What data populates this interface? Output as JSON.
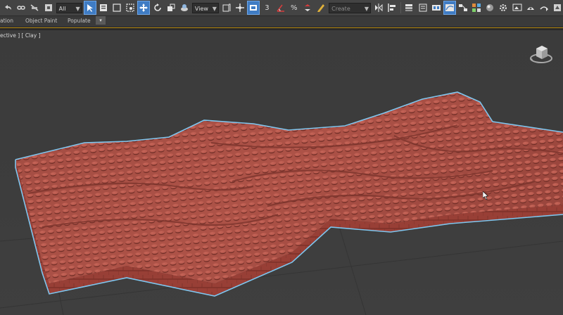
{
  "toolbar": {
    "selection_filter": "All",
    "view_dropdown": "View",
    "selection_set": "Create Selection Se",
    "percent_snap_label": "%",
    "snap_label": "3",
    "tools": [
      "undo-icon",
      "redo-icon",
      "link-icon",
      "unlink-icon",
      "bind-space-warp-icon",
      "select-object-icon",
      "select-by-name-icon",
      "rectangular-selection-region-icon",
      "window-crossing-icon",
      "select-and-move-icon",
      "select-and-rotate-icon",
      "select-and-scale-icon",
      "select-and-place-icon",
      "use-pivot-center-icon",
      "select-and-manipulate-icon",
      "keyboard-shortcut-override-icon",
      "snaps-toggle-icon",
      "angle-snap-icon",
      "percent-snap-icon",
      "spinner-snap-icon",
      "edit-named-selection-icon",
      "mirror-icon",
      "align-icon",
      "layer-explorer-icon",
      "toggle-ribbon-icon",
      "curve-editor-icon",
      "schematic-view-icon",
      "material-editor-icon",
      "render-setup-icon",
      "rendered-frame-window-icon",
      "render-production-icon",
      "render-iterative-icon"
    ]
  },
  "ribbon": {
    "tabs": [
      "ation",
      "Object Paint",
      "Populate"
    ],
    "toggle_glyph": "▾"
  },
  "viewport": {
    "label": "ective ] [ Clay ]",
    "object_color": "#a94f45",
    "selection_outline_color": "#7ec6ef",
    "background_color": "#3d3d3d"
  },
  "colors": {
    "toolbar_bg": "#444444",
    "active_button": "#3f7cc4",
    "ribbon_bg": "#3a3a3a",
    "accent_line": "#b88a12"
  }
}
